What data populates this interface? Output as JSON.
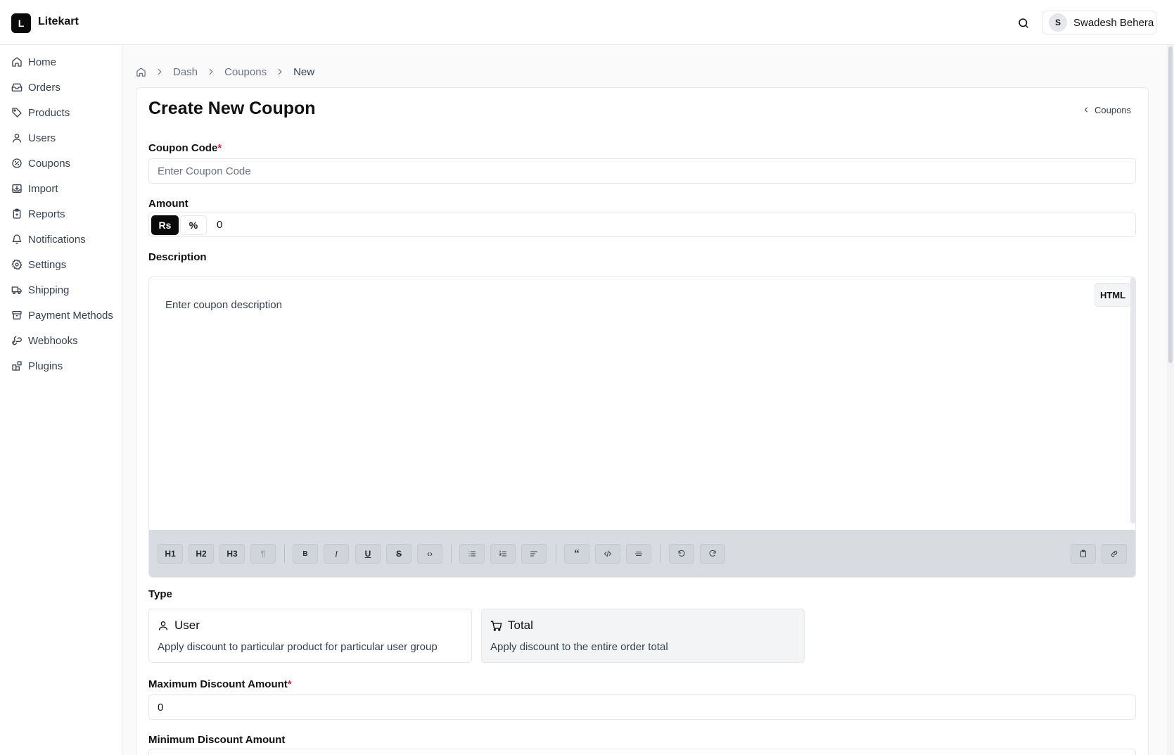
{
  "app": {
    "logo_letter": "L",
    "name": "Litekart"
  },
  "header": {
    "user_initial": "S",
    "user_name": "Swadesh Behera"
  },
  "sidebar": {
    "items": [
      {
        "label": "Home",
        "icon": "home-icon"
      },
      {
        "label": "Orders",
        "icon": "inbox-icon"
      },
      {
        "label": "Products",
        "icon": "tag-icon"
      },
      {
        "label": "Users",
        "icon": "user-icon"
      },
      {
        "label": "Coupons",
        "icon": "badge-percent-icon"
      },
      {
        "label": "Import",
        "icon": "import-icon"
      },
      {
        "label": "Reports",
        "icon": "clipboard-icon"
      },
      {
        "label": "Notifications",
        "icon": "bell-icon"
      },
      {
        "label": "Settings",
        "icon": "gear-icon"
      },
      {
        "label": "Shipping",
        "icon": "truck-icon"
      },
      {
        "label": "Payment Methods",
        "icon": "archive-icon"
      },
      {
        "label": "Webhooks",
        "icon": "webhook-icon"
      },
      {
        "label": "Plugins",
        "icon": "blocks-icon"
      }
    ]
  },
  "breadcrumb": {
    "items": [
      "Dash",
      "Coupons",
      "New"
    ]
  },
  "page": {
    "title": "Create New Coupon",
    "back_label": "Coupons"
  },
  "form": {
    "coupon_code": {
      "label": "Coupon Code",
      "required_mark": "*",
      "placeholder": "Enter Coupon Code",
      "value": ""
    },
    "amount": {
      "label": "Amount",
      "currency_option": "Rs",
      "percent_option": "%",
      "selected": "Rs",
      "value": "0"
    },
    "description": {
      "label": "Description",
      "placeholder": "Enter coupon description",
      "html_button": "HTML",
      "toolbar": {
        "h1": "H1",
        "h2": "H2",
        "h3": "H3",
        "paragraph": "¶",
        "bold": "B",
        "italic": "I",
        "underline": "U",
        "strike": "S",
        "code": "‹›",
        "bullet_list": "bullet-list-icon",
        "ordered_list": "ordered-list-icon",
        "align": "align-icon",
        "quote": "“",
        "code_block": "code-block-icon",
        "hr": "horizontal-rule-icon",
        "undo": "undo-icon",
        "redo": "redo-icon",
        "clipboard": "clipboard-icon",
        "link": "link-icon"
      }
    },
    "type": {
      "label": "Type",
      "options": [
        {
          "title": "User",
          "description": "Apply discount to particular product for particular user group",
          "icon": "user-icon"
        },
        {
          "title": "Total",
          "description": "Apply discount to the entire order total",
          "icon": "cart-icon"
        }
      ],
      "selected": "Total"
    },
    "max_discount": {
      "label": "Maximum Discount Amount",
      "required_mark": "*",
      "value": "0"
    },
    "min_discount": {
      "label": "Minimum Discount Amount"
    }
  },
  "colors": {
    "accent": "#0a0a0a",
    "required": "#e11d48",
    "border": "#e5e7eb",
    "toolbar_bg": "#d8dce1"
  }
}
